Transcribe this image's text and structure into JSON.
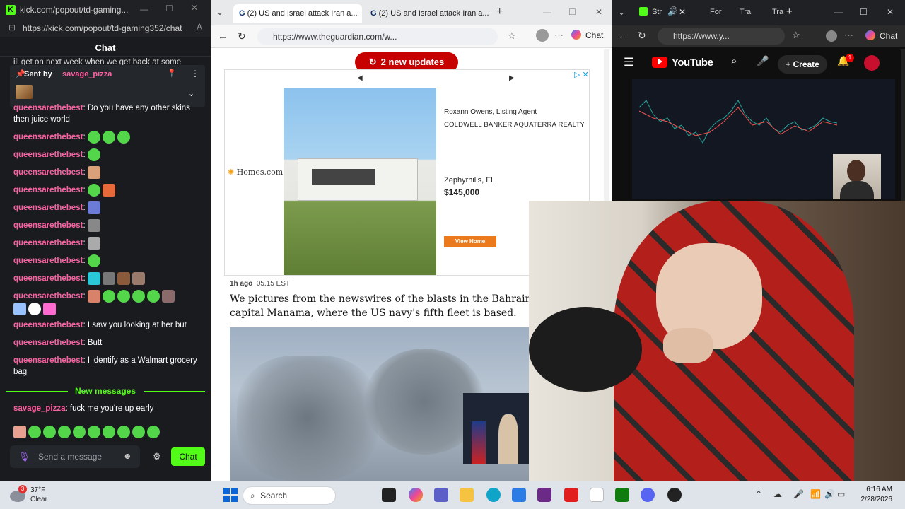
{
  "kick": {
    "url": "kick.com/popout/td-gaming...",
    "address": "https://kick.com/popout/td-gaming352/chat",
    "header": "Chat",
    "top_snippet": "ill get on next week when we get back at some",
    "pinned": {
      "label": "Sent by",
      "user": "savage_pizza"
    },
    "messages": [
      {
        "user": "queensarethebest",
        "text": "Do you have any other skins then juice world"
      },
      {
        "user": "queensarethebest",
        "text": ""
      },
      {
        "user": "queensarethebest",
        "text": ""
      },
      {
        "user": "queensarethebest",
        "text": ""
      },
      {
        "user": "queensarethebest",
        "text": ""
      },
      {
        "user": "queensarethebest",
        "text": ""
      },
      {
        "user": "queensarethebest",
        "text": ""
      },
      {
        "user": "queensarethebest",
        "text": ""
      },
      {
        "user": "queensarethebest",
        "text": ""
      },
      {
        "user": "queensarethebest",
        "text": ""
      },
      {
        "user": "queensarethebest",
        "text": ""
      },
      {
        "user": "queensarethebest",
        "text": "I saw you looking at her but"
      },
      {
        "user": "queensarethebest",
        "text": "Butt"
      },
      {
        "user": "queensarethebest",
        "text": "I identify as a Walmart grocery bag"
      }
    ],
    "new_messages_label": "New messages",
    "last_message": {
      "user": "savage_pizza",
      "text": "fuck me you're up early"
    },
    "input_placeholder": "Send a message",
    "chat_button": "Chat",
    "accent": "#53fc18"
  },
  "guardian": {
    "tabs": [
      {
        "label": "(2) US and Israel attack Iran a..."
      },
      {
        "label": "(2) US and Israel attack Iran a..."
      }
    ],
    "address": "https://www.theguardian.com/w...",
    "copilot_label": "Chat",
    "updates_label": "2 new updates",
    "ad": {
      "agent": "Roxann Owens, Listing Agent",
      "brokerage": "COLDWELL BANKER AQUATERRA REALTY",
      "logo": "Homes.com",
      "location": "Zephyrhills, FL",
      "price": "$145,000",
      "cta": "View Home"
    },
    "post": {
      "age": "1h ago",
      "time": "05.15 EST",
      "text": "We pictures from the newswires of the blasts in the Bahraini capital Manama, where the US navy's fifth fleet is based."
    },
    "accent": "#c70000"
  },
  "youtube": {
    "tabs": [
      "Str",
      "For",
      "Tra",
      "Tra"
    ],
    "address": "https://www.y...",
    "copilot_label": "Chat",
    "logo": "YouTube",
    "create_label": "Create",
    "notification_count": "1"
  },
  "taskbar": {
    "weather_temp": "37°F",
    "weather_desc": "Clear",
    "weather_badge": "3",
    "search_label": "Search",
    "time": "6:16 AM",
    "date": "2/28/2026"
  }
}
